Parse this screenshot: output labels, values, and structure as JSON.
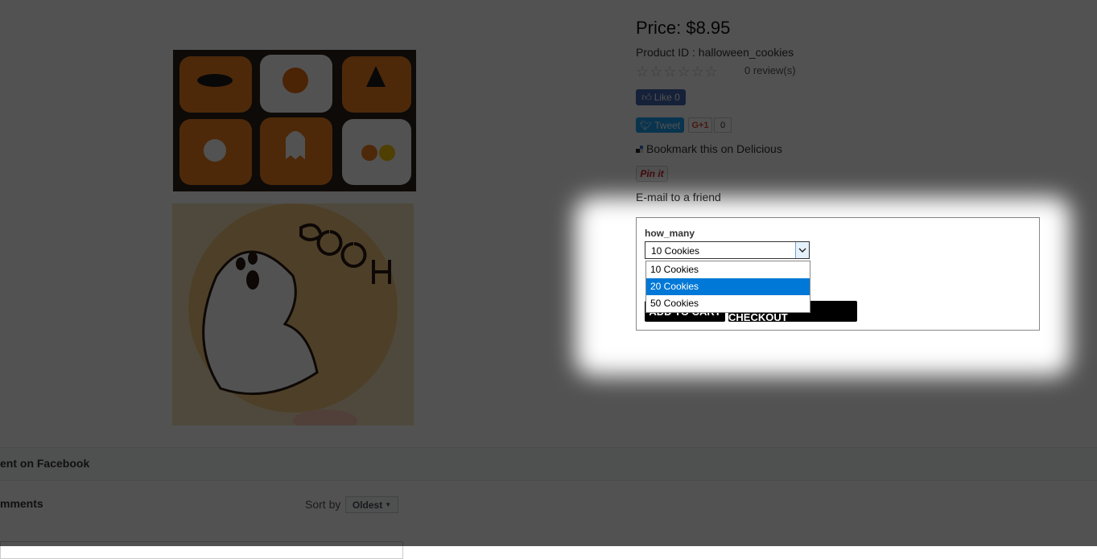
{
  "product": {
    "price": "Price: $8.95",
    "product_id": "Product ID : halloween_cookies",
    "stars": "☆☆☆☆☆☆",
    "reviews": "0 review(s)"
  },
  "social": {
    "fb_like": "Like 0",
    "tweet": "Tweet",
    "gplus": "G+1",
    "gplus_count": "0",
    "delicious": "Bookmark this on Delicious",
    "pinit": "Pin it",
    "email_friend": "E-mail to a friend"
  },
  "form": {
    "field_label": "how_many",
    "selected": "10 Cookies",
    "options": [
      "10 Cookies",
      "20 Cookies",
      "50 Cookies"
    ],
    "highlighted_option": "20 Cookies",
    "add_to_cart": "ADD TO CART",
    "checkout": "PROCEED TO CHECKOUT"
  },
  "comments": {
    "fb_header": "ent on Facebook",
    "title": "mments",
    "sort_label": "Sort by",
    "sort_value": "Oldest"
  },
  "colors": {
    "overlay": "#000000",
    "highlight": "#0078d7",
    "facebook": "#4267b2",
    "twitter": "#1da1f2"
  }
}
